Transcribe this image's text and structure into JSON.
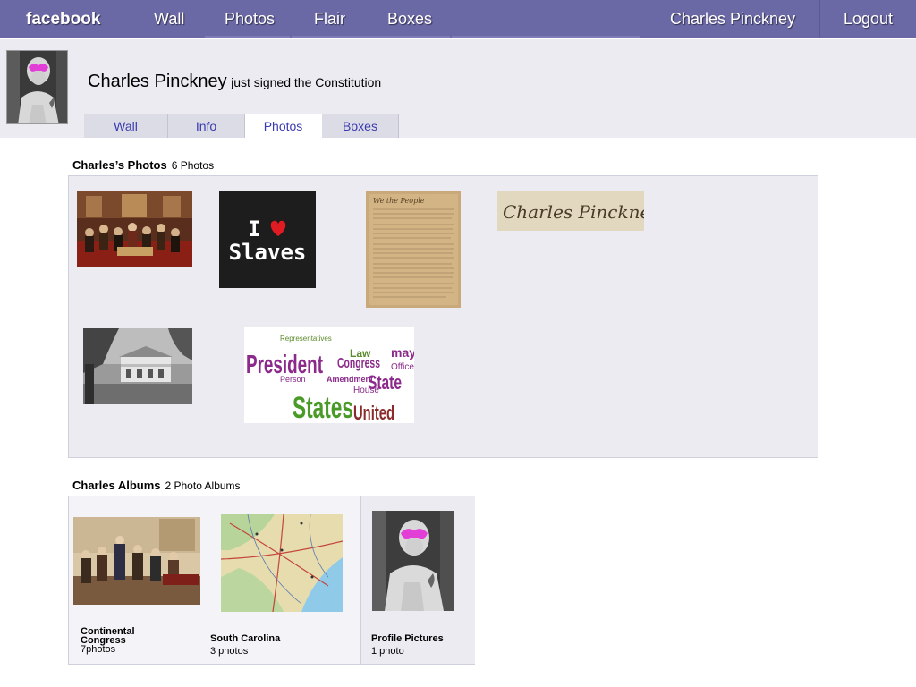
{
  "topbar": {
    "brand": "facebook",
    "nav": [
      "Wall",
      "Photos",
      "Flair",
      "Boxes"
    ],
    "user": "Charles Pinckney",
    "logout": "Logout",
    "color": "#6b68a6"
  },
  "profile": {
    "name": "Charles Pinckney",
    "status": "just signed the Constitution",
    "tabs": [
      "Wall",
      "Info",
      "Photos",
      "Boxes"
    ],
    "active_tab": "Photos"
  },
  "photos": {
    "title": "Charles’s Photos",
    "count": "6 Photos",
    "items": [
      {
        "name": "signing-painting"
      },
      {
        "name": "i-heart-slaves",
        "line1": "I",
        "line2": "Slaves"
      },
      {
        "name": "constitution-document"
      },
      {
        "name": "signature",
        "text": "Charles Pinckney"
      },
      {
        "name": "plantation-house"
      },
      {
        "name": "word-cloud",
        "words": [
          "President",
          "Congress",
          "States",
          "United",
          "Law",
          "State",
          "Office",
          "may",
          "Amendment",
          "House",
          "Person",
          "Representatives"
        ]
      }
    ]
  },
  "albums": {
    "title": "Charles Albums",
    "count": "2 Photo Albums",
    "items": [
      {
        "name": "Continental Congress",
        "count": "7photos"
      },
      {
        "name": "South Carolina",
        "count": "3 photos"
      },
      {
        "name": "Profile Pictures",
        "count": "1 photo"
      }
    ]
  }
}
